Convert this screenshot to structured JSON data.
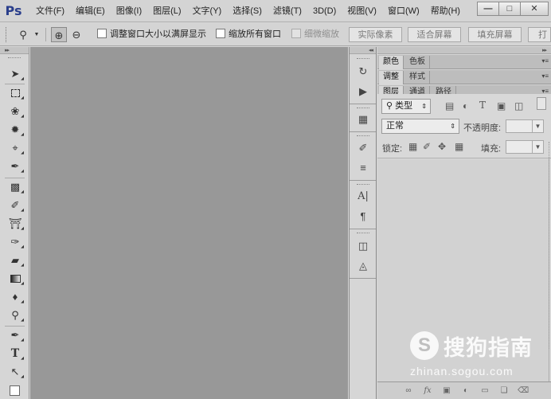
{
  "app": {
    "logo": "Ps"
  },
  "menu": [
    "文件(F)",
    "编辑(E)",
    "图像(I)",
    "图层(L)",
    "文字(Y)",
    "选择(S)",
    "滤镜(T)",
    "3D(D)",
    "视图(V)",
    "窗口(W)",
    "帮助(H)"
  ],
  "window_controls": {
    "minimize": "—",
    "maximize": "□",
    "close": "✕"
  },
  "options_bar": {
    "tool_icon": "zoom-tool-icon",
    "resize_windows_label": "调整窗口大小以满屏显示",
    "zoom_all_windows_label": "缩放所有窗口",
    "scrubby_zoom_label": "细微缩放",
    "actual_pixels_label": "实际像素",
    "fit_screen_label": "适合屏幕",
    "fill_screen_label": "填充屏幕",
    "print_size_label": "打"
  },
  "panel_tabs": {
    "row1": [
      "颜色",
      "色板"
    ],
    "row2": [
      "调整",
      "样式"
    ],
    "row3": [
      "图层",
      "通道",
      "路径"
    ]
  },
  "layers_panel": {
    "filter_kind": "类型",
    "blend_mode": "正常",
    "opacity_label": "不透明度:",
    "lock_label": "锁定:",
    "fill_label": "填充:"
  },
  "watermark": {
    "logo_letter": "S",
    "text": "搜狗指南",
    "url": "zhinan.sogou.com"
  },
  "colors": {
    "canvas_bg": "#989898",
    "ui_bg": "#d6d6d6",
    "logo_blue": "#2b3f8c"
  }
}
